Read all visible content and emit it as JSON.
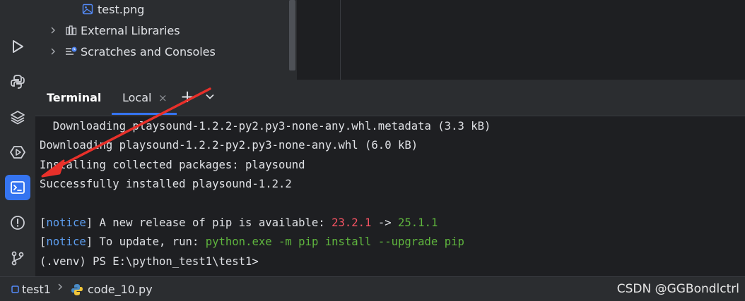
{
  "project_tree": {
    "items": [
      {
        "label": "test.png",
        "icon": "image-file-icon"
      },
      {
        "label": "External Libraries",
        "icon": "library-icon"
      },
      {
        "label": "Scratches and Consoles",
        "icon": "scratches-icon"
      }
    ]
  },
  "activity_bar": {
    "icons": [
      "run-icon",
      "python-console-icon",
      "layers-icon",
      "services-icon",
      "terminal-icon",
      "problems-icon",
      "git-icon"
    ],
    "active": "terminal-icon"
  },
  "terminal": {
    "title": "Terminal",
    "tab_label": "Local",
    "tab_close": "×",
    "new_tab": "+",
    "lines": {
      "l1": "  Downloading playsound-1.2.2-py2.py3-none-any.whl.metadata (3.3 kB)",
      "l2": "Downloading playsound-1.2.2-py2.py3-none-any.whl (6.0 kB)",
      "l3": "Installing collected packages: playsound",
      "l4": "Successfully installed playsound-1.2.2",
      "l6_open": "[",
      "l6_tag": "notice",
      "l6_close": "]",
      "l6_text": " A new release of pip is available: ",
      "l6_old": "23.2.1",
      "l6_arrow": " -> ",
      "l6_new": "25.1.1",
      "l7_open": "[",
      "l7_tag": "notice",
      "l7_close": "]",
      "l7_text": " To update, run: ",
      "l7_cmd": "python.exe -m pip install --upgrade pip",
      "l8": "(.venv) PS E:\\python_test1\\test1>"
    }
  },
  "status_bar": {
    "project": "test1",
    "separator": ">",
    "file": "code_10.py"
  },
  "watermark": "CSDN @GGBondlctrl",
  "colors": {
    "accent": "#3574f0",
    "arrow": "#e8302a",
    "notice": "#5d9ef0",
    "version_old": "#f75464",
    "version_new": "#5fb53e"
  }
}
